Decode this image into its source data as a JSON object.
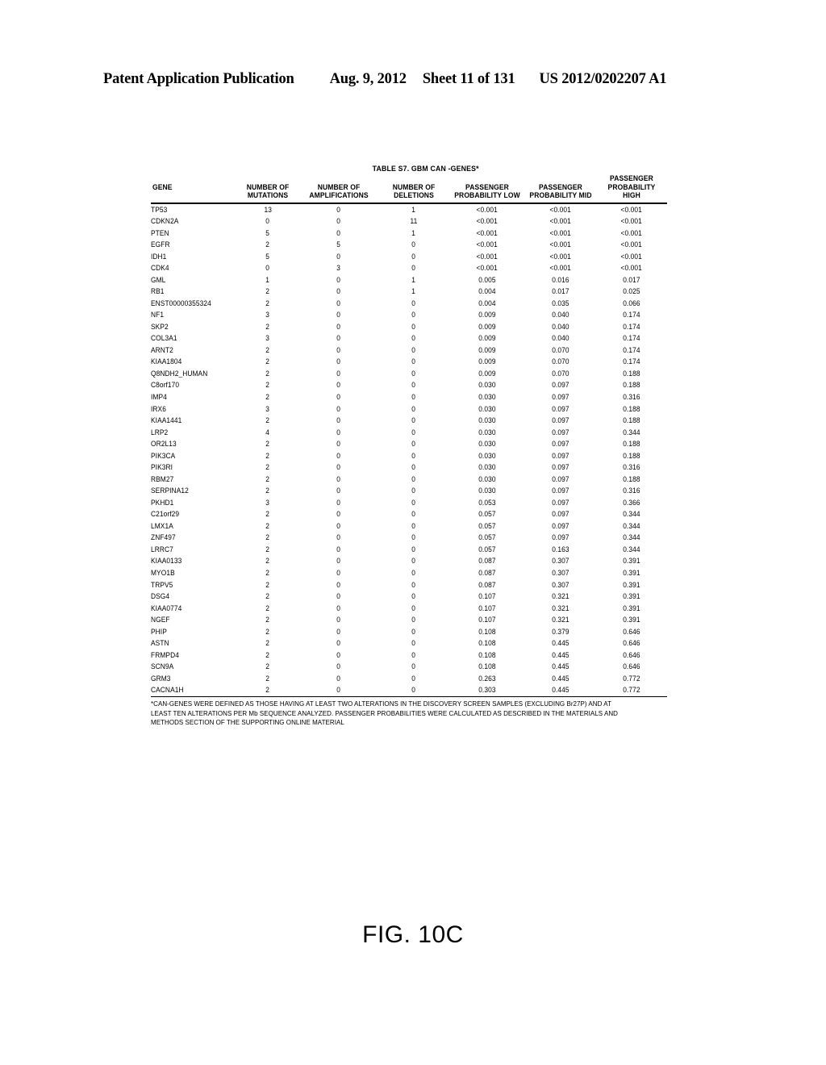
{
  "header": {
    "publication": "Patent Application Publication",
    "date": "Aug. 9, 2012",
    "sheet": "Sheet 11 of 131",
    "doc_number": "US 2012/0202207 A1"
  },
  "figure": {
    "caption": "FIG. 10C",
    "table_title": "TABLE S7. GBM CAN -GENES*"
  },
  "table": {
    "columns": [
      {
        "key": "gene",
        "line1": "GENE",
        "line2": ""
      },
      {
        "key": "mut",
        "line1": "NUMBER OF",
        "line2": "MUTATIONS"
      },
      {
        "key": "amp",
        "line1": "NUMBER OF",
        "line2": "AMPLIFICATIONS"
      },
      {
        "key": "del",
        "line1": "NUMBER OF",
        "line2": "DELETIONS"
      },
      {
        "key": "plow",
        "line1": "PASSENGER",
        "line2": "PROBABILITY LOW"
      },
      {
        "key": "pmid",
        "line1": "PASSENGER",
        "line2": "PROBABILITY MID"
      },
      {
        "key": "phigh",
        "line1": "PASSENGER",
        "line2": "PROBABILITY HIGH"
      }
    ],
    "rows": [
      [
        "TP53",
        "13",
        "0",
        "1",
        "<0.001",
        "<0.001",
        "<0.001"
      ],
      [
        "CDKN2A",
        "0",
        "0",
        "11",
        "<0.001",
        "<0.001",
        "<0.001"
      ],
      [
        "PTEN",
        "5",
        "0",
        "1",
        "<0.001",
        "<0.001",
        "<0.001"
      ],
      [
        "EGFR",
        "2",
        "5",
        "0",
        "<0.001",
        "<0.001",
        "<0.001"
      ],
      [
        "IDH1",
        "5",
        "0",
        "0",
        "<0.001",
        "<0.001",
        "<0.001"
      ],
      [
        "CDK4",
        "0",
        "3",
        "0",
        "<0.001",
        "<0.001",
        "<0.001"
      ],
      [
        "GML",
        "1",
        "0",
        "1",
        "0.005",
        "0.016",
        "0.017"
      ],
      [
        "RB1",
        "2",
        "0",
        "1",
        "0.004",
        "0.017",
        "0.025"
      ],
      [
        "ENST00000355324",
        "2",
        "0",
        "0",
        "0.004",
        "0.035",
        "0.066"
      ],
      [
        "NF1",
        "3",
        "0",
        "0",
        "0.009",
        "0.040",
        "0.174"
      ],
      [
        "SKP2",
        "2",
        "0",
        "0",
        "0.009",
        "0.040",
        "0.174"
      ],
      [
        "COL3A1",
        "3",
        "0",
        "0",
        "0.009",
        "0.040",
        "0.174"
      ],
      [
        "ARNT2",
        "2",
        "0",
        "0",
        "0.009",
        "0.070",
        "0.174"
      ],
      [
        "KIAA1804",
        "2",
        "0",
        "0",
        "0.009",
        "0.070",
        "0.174"
      ],
      [
        "Q8NDH2_HUMAN",
        "2",
        "0",
        "0",
        "0.009",
        "0.070",
        "0.188"
      ],
      [
        "C8orf170",
        "2",
        "0",
        "0",
        "0.030",
        "0.097",
        "0.188"
      ],
      [
        "IMP4",
        "2",
        "0",
        "0",
        "0.030",
        "0.097",
        "0.316"
      ],
      [
        "IRX6",
        "3",
        "0",
        "0",
        "0.030",
        "0.097",
        "0.188"
      ],
      [
        "KIAA1441",
        "2",
        "0",
        "0",
        "0.030",
        "0.097",
        "0.188"
      ],
      [
        "LRP2",
        "4",
        "0",
        "0",
        "0.030",
        "0.097",
        "0.344"
      ],
      [
        "OR2L13",
        "2",
        "0",
        "0",
        "0.030",
        "0.097",
        "0.188"
      ],
      [
        "PIK3CA",
        "2",
        "0",
        "0",
        "0.030",
        "0.097",
        "0.188"
      ],
      [
        "PIK3RI",
        "2",
        "0",
        "0",
        "0.030",
        "0.097",
        "0.316"
      ],
      [
        "RBM27",
        "2",
        "0",
        "0",
        "0.030",
        "0.097",
        "0.188"
      ],
      [
        "SERPINA12",
        "2",
        "0",
        "0",
        "0.030",
        "0.097",
        "0.316"
      ],
      [
        "PKHD1",
        "3",
        "0",
        "0",
        "0.053",
        "0.097",
        "0.366"
      ],
      [
        "C21orf29",
        "2",
        "0",
        "0",
        "0.057",
        "0.097",
        "0.344"
      ],
      [
        "LMX1A",
        "2",
        "0",
        "0",
        "0.057",
        "0.097",
        "0.344"
      ],
      [
        "ZNF497",
        "2",
        "0",
        "0",
        "0.057",
        "0.097",
        "0.344"
      ],
      [
        "LRRC7",
        "2",
        "0",
        "0",
        "0.057",
        "0.163",
        "0.344"
      ],
      [
        "KIAA0133",
        "2",
        "0",
        "0",
        "0.087",
        "0.307",
        "0.391"
      ],
      [
        "MYO1B",
        "2",
        "0",
        "0",
        "0.087",
        "0.307",
        "0.391"
      ],
      [
        "TRPV5",
        "2",
        "0",
        "0",
        "0.087",
        "0.307",
        "0.391"
      ],
      [
        "DSG4",
        "2",
        "0",
        "0",
        "0.107",
        "0.321",
        "0.391"
      ],
      [
        "KIAA0774",
        "2",
        "0",
        "0",
        "0.107",
        "0.321",
        "0.391"
      ],
      [
        "NGEF",
        "2",
        "0",
        "0",
        "0.107",
        "0.321",
        "0.391"
      ],
      [
        "PHIP",
        "2",
        "0",
        "0",
        "0.108",
        "0.379",
        "0.646"
      ],
      [
        "ASTN",
        "2",
        "0",
        "0",
        "0.108",
        "0.445",
        "0.646"
      ],
      [
        "FRMPD4",
        "2",
        "0",
        "0",
        "0.108",
        "0.445",
        "0.646"
      ],
      [
        "SCN9A",
        "2",
        "0",
        "0",
        "0.108",
        "0.445",
        "0.646"
      ],
      [
        "GRM3",
        "2",
        "0",
        "0",
        "0.263",
        "0.445",
        "0.772"
      ],
      [
        "CACNA1H",
        "2",
        "0",
        "0",
        "0.303",
        "0.445",
        "0.772"
      ]
    ]
  },
  "footnote": {
    "line1": "*CAN-GENES WERE DEFINED AS THOSE HAVING AT LEAST TWO ALTERATIONS IN THE DISCOVERY SCREEN SAMPLES (EXCLUDING Br27P) AND AT",
    "line2": "LEAST TEN ALTERATIONS PER Mb SEQUENCE ANALYZED. PASSENGER PROBABILITIES WERE CALCULATED AS DESCRIBED IN THE MATERIALS AND",
    "line3": "METHODS SECTION OF THE SUPPORTING ONLINE MATERIAL"
  }
}
